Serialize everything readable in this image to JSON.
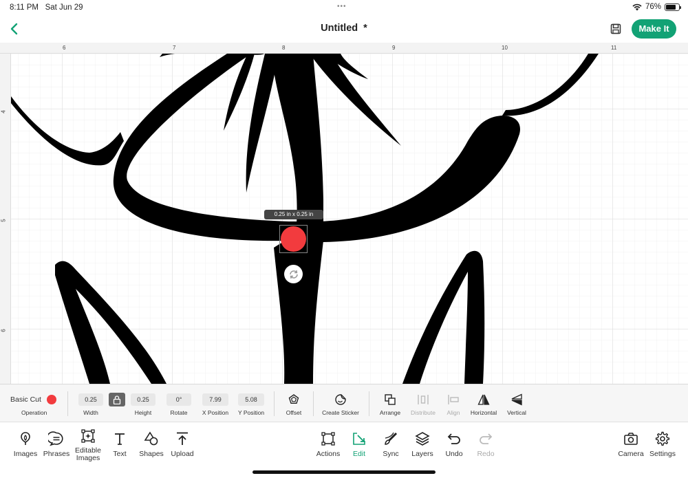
{
  "status_bar": {
    "time": "8:11 PM",
    "date": "Sat Jun 29",
    "battery": "76%",
    "battery_level": 0.76
  },
  "header": {
    "title": "Untitled  *",
    "make_it_label": "Make It"
  },
  "ruler": {
    "top": [
      "6",
      "7",
      "8",
      "9",
      "10",
      "11"
    ],
    "left": [
      "4",
      "5",
      "6"
    ]
  },
  "canvas": {
    "size_tooltip": "0.25 in x 0.25 in",
    "shape_color": "#f23b3e"
  },
  "edit_toolbar": {
    "operation_value": "Basic Cut",
    "operation_label": "Operation",
    "width_value": "0.25",
    "width_label": "Width",
    "height_value": "0.25",
    "height_label": "Height",
    "rotate_value": "0°",
    "rotate_label": "Rotate",
    "x_value": "7.99",
    "x_label": "X Position",
    "y_value": "5.08",
    "y_label": "Y Position",
    "offset_label": "Offset",
    "create_sticker_label": "Create Sticker",
    "arrange_label": "Arrange",
    "distribute_label": "Distribute",
    "align_label": "Align",
    "horizontal_label": "Horizontal",
    "vertical_label": "Vertical"
  },
  "bottom_nav": {
    "images": "Images",
    "phrases": "Phrases",
    "editable_images": "Editable Images",
    "text": "Text",
    "shapes": "Shapes",
    "upload": "Upload",
    "actions": "Actions",
    "edit": "Edit",
    "sync": "Sync",
    "layers": "Layers",
    "undo": "Undo",
    "redo": "Redo",
    "camera": "Camera",
    "settings": "Settings"
  },
  "colors": {
    "accent": "#12a275",
    "operation_dot": "#f23b3e"
  }
}
